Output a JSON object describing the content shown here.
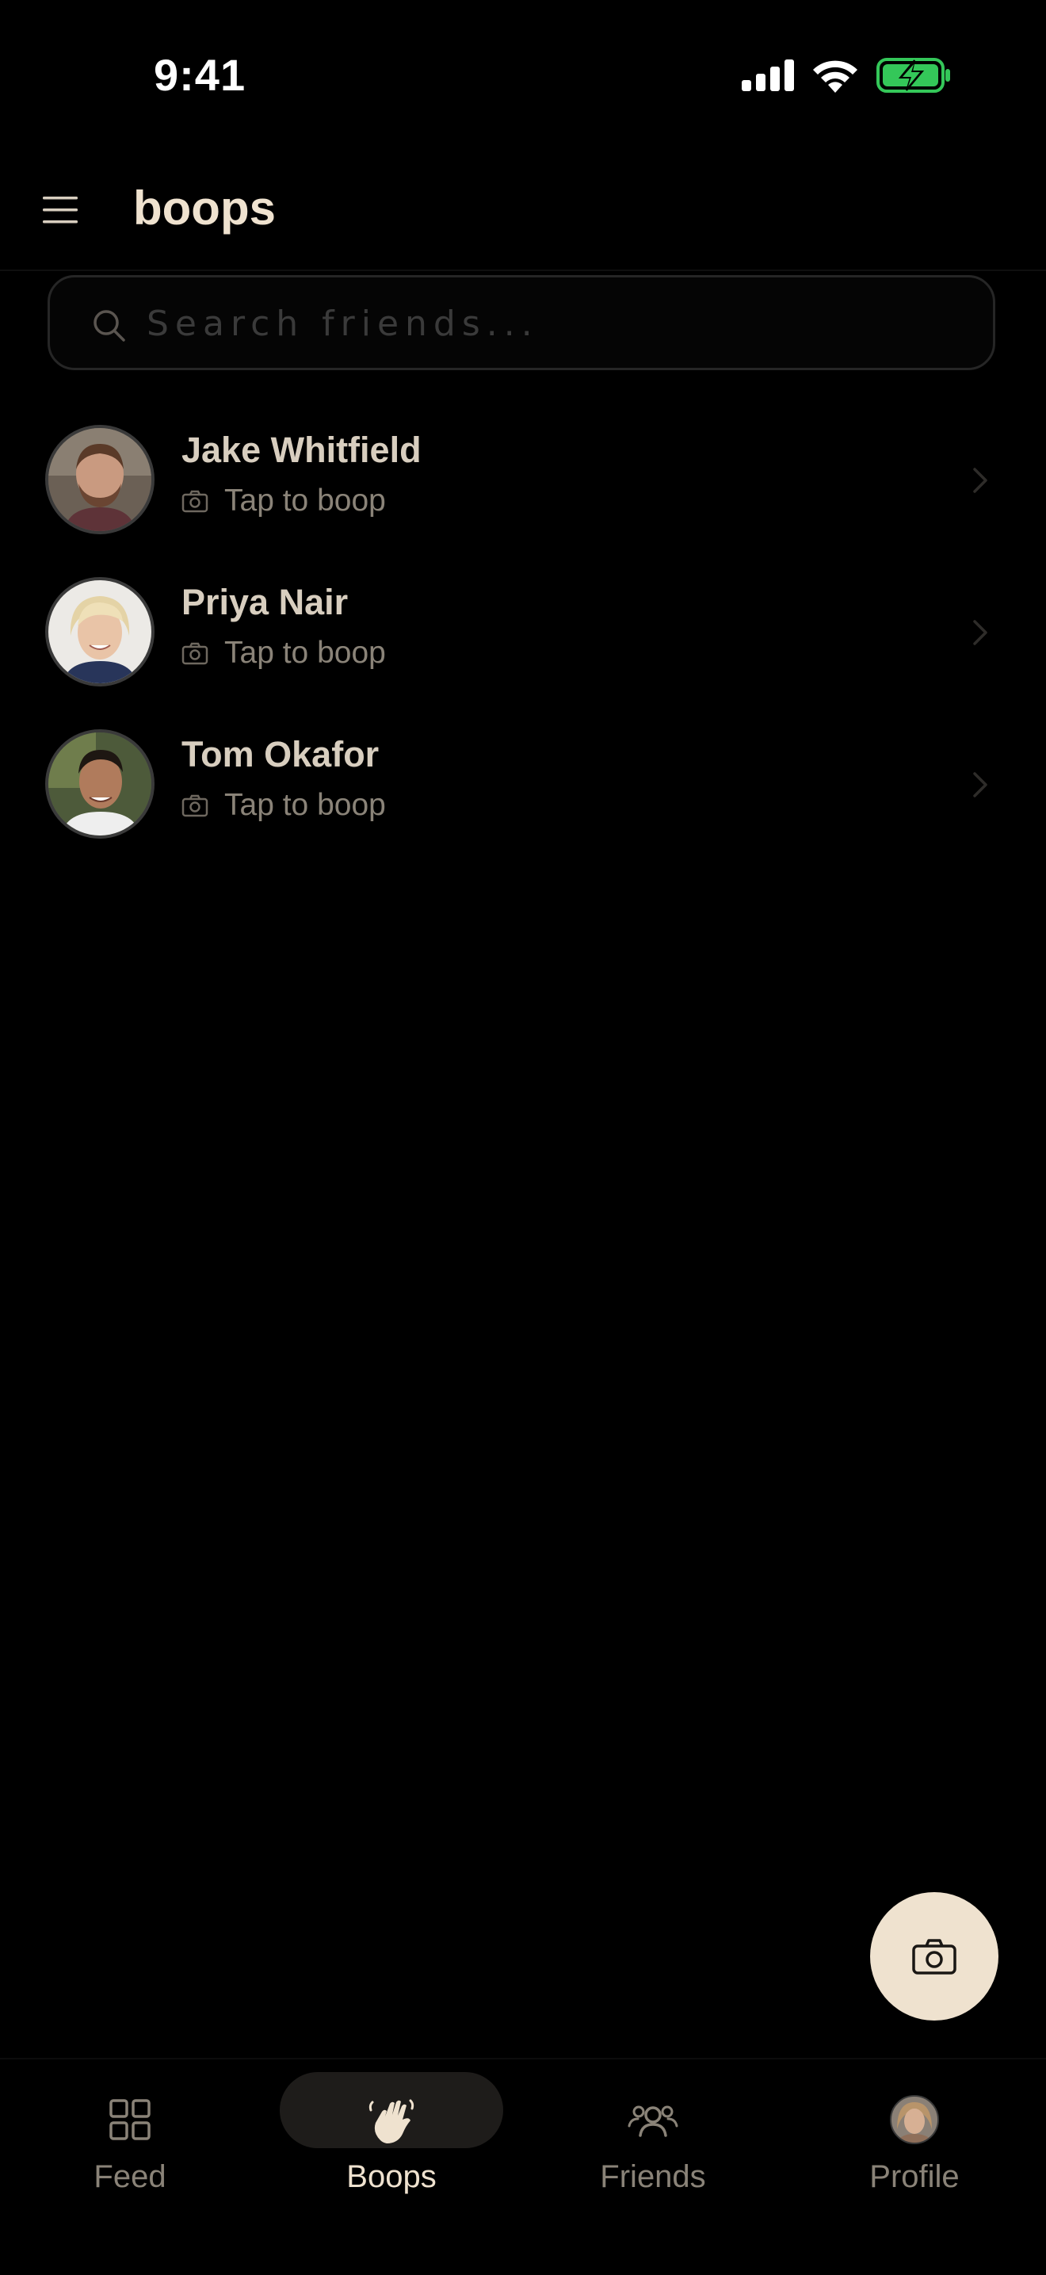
{
  "status_bar": {
    "time": "9:41"
  },
  "header": {
    "title": "boops",
    "menu_icon": "hamburger-icon"
  },
  "search": {
    "placeholder": "Search friends...",
    "value": ""
  },
  "friends": [
    {
      "name": "Jake Whitfield",
      "subtitle": "Tap to boop"
    },
    {
      "name": "Priya Nair",
      "subtitle": "Tap to boop"
    },
    {
      "name": "Tom Okafor",
      "subtitle": "Tap to boop"
    }
  ],
  "fab": {
    "icon": "camera-icon"
  },
  "tabs": [
    {
      "label": "Feed",
      "icon": "grid-icon",
      "active": false
    },
    {
      "label": "Boops",
      "icon": "waving-hand-icon",
      "active": true
    },
    {
      "label": "Friends",
      "icon": "friends-icon",
      "active": false
    },
    {
      "label": "Profile",
      "icon": "profile-avatar",
      "active": false
    }
  ],
  "colors": {
    "background": "#000000",
    "accent": "#efe2cf",
    "battery": "#34c759"
  }
}
